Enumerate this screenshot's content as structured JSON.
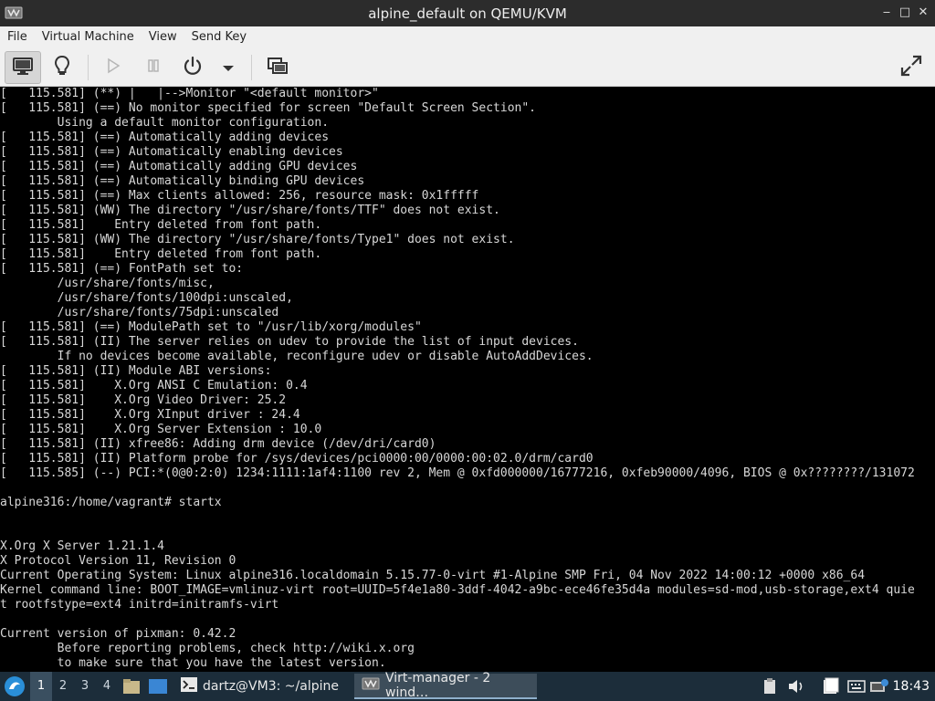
{
  "window": {
    "title": "alpine_default on QEMU/KVM",
    "controls": {
      "minimize": "‒",
      "maximize": "□",
      "close": "✕"
    }
  },
  "menu": {
    "items": [
      "File",
      "Virtual Machine",
      "View",
      "Send Key"
    ]
  },
  "toolbar": {
    "buttons": [
      {
        "name": "console-view-button",
        "icon": "monitor-icon",
        "active": true
      },
      {
        "name": "details-view-button",
        "icon": "lightbulb-icon",
        "active": false
      },
      {
        "name": "run-button",
        "icon": "play-icon",
        "active": false
      },
      {
        "name": "pause-button",
        "icon": "pause-icon",
        "active": false
      },
      {
        "name": "power-button",
        "icon": "power-icon",
        "active": false
      },
      {
        "name": "power-menu-button",
        "icon": "chevron-down-icon",
        "active": false
      },
      {
        "name": "snapshots-button",
        "icon": "snapshots-icon",
        "active": false
      },
      {
        "name": "fullscreen-button",
        "icon": "fullscreen-icon",
        "active": false
      }
    ]
  },
  "console": {
    "lines": [
      "[   115.581] (**) |   |-->Monitor \"<default monitor>\"",
      "[   115.581] (==) No monitor specified for screen \"Default Screen Section\".",
      "        Using a default monitor configuration.",
      "[   115.581] (==) Automatically adding devices",
      "[   115.581] (==) Automatically enabling devices",
      "[   115.581] (==) Automatically adding GPU devices",
      "[   115.581] (==) Automatically binding GPU devices",
      "[   115.581] (==) Max clients allowed: 256, resource mask: 0x1fffff",
      "[   115.581] (WW) The directory \"/usr/share/fonts/TTF\" does not exist.",
      "[   115.581]    Entry deleted from font path.",
      "[   115.581] (WW) The directory \"/usr/share/fonts/Type1\" does not exist.",
      "[   115.581]    Entry deleted from font path.",
      "[   115.581] (==) FontPath set to:",
      "        /usr/share/fonts/misc,",
      "        /usr/share/fonts/100dpi:unscaled,",
      "        /usr/share/fonts/75dpi:unscaled",
      "[   115.581] (==) ModulePath set to \"/usr/lib/xorg/modules\"",
      "[   115.581] (II) The server relies on udev to provide the list of input devices.",
      "        If no devices become available, reconfigure udev or disable AutoAddDevices.",
      "[   115.581] (II) Module ABI versions:",
      "[   115.581]    X.Org ANSI C Emulation: 0.4",
      "[   115.581]    X.Org Video Driver: 25.2",
      "[   115.581]    X.Org XInput driver : 24.4",
      "[   115.581]    X.Org Server Extension : 10.0",
      "[   115.581] (II) xfree86: Adding drm device (/dev/dri/card0)",
      "[   115.581] (II) Platform probe for /sys/devices/pci0000:00/0000:00:02.0/drm/card0",
      "[   115.585] (--) PCI:*(0@0:2:0) 1234:1111:1af4:1100 rev 2, Mem @ 0xfd000000/16777216, 0xfeb90000/4096, BIOS @ 0x????????/131072",
      "",
      "alpine316:/home/vagrant# startx",
      "",
      "",
      "X.Org X Server 1.21.1.4",
      "X Protocol Version 11, Revision 0",
      "Current Operating System: Linux alpine316.localdomain 5.15.77-0-virt #1-Alpine SMP Fri, 04 Nov 2022 14:00:12 +0000 x86_64",
      "Kernel command line: BOOT_IMAGE=vmlinuz-virt root=UUID=5f4e1a80-3ddf-4042-a9bc-ece46fe35d4a modules=sd-mod,usb-storage,ext4 quie",
      "t rootfstype=ext4 initrd=initramfs-virt",
      "",
      "Current version of pixman: 0.42.2",
      "        Before reporting problems, check http://wiki.x.org",
      "        to make sure that you have the latest version."
    ]
  },
  "taskbar": {
    "workspaces": [
      "1",
      "2",
      "3",
      "4"
    ],
    "active_workspace": "1",
    "tasks": [
      {
        "label": "dartz@VM3: ~/alpine",
        "icon": "terminal-icon",
        "active": false
      },
      {
        "label": "Virt-manager - 2 wind…",
        "icon": "virt-manager-icon",
        "active": true
      }
    ],
    "clock": "18:43"
  }
}
